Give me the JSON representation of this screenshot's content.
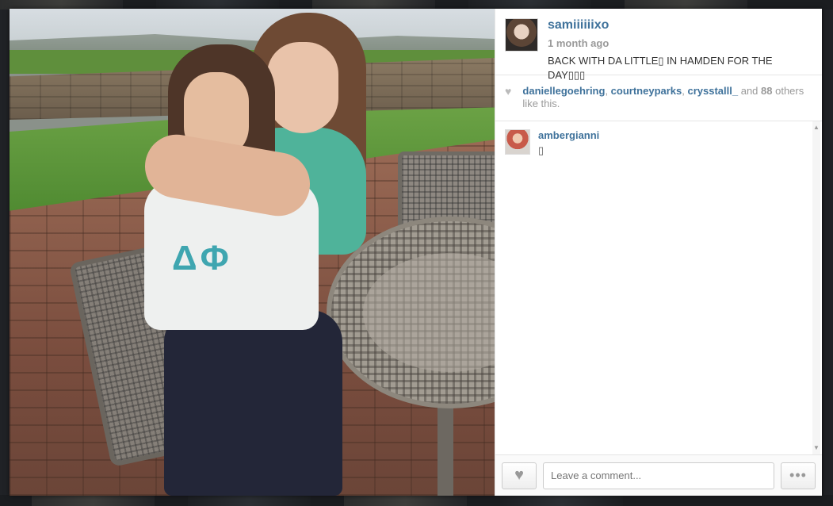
{
  "post": {
    "username": "samiiiiiixo",
    "time_ago": "1 month ago",
    "caption": "BACK WITH DA LITTLE▯ IN HAMDEN FOR THE DAY▯▯▯"
  },
  "likes": {
    "users": [
      "daniellegoehring",
      "courtneyparks",
      "crysstalll_"
    ],
    "separator1": ", ",
    "separator2": ", ",
    "and_text": " and ",
    "count": "88",
    "suffix": " others like this."
  },
  "comments": [
    {
      "username": "ambergianni",
      "text": "▯"
    }
  ],
  "footer": {
    "comment_placeholder": "Leave a comment...",
    "like_icon": "heart-icon",
    "more_icon": "ellipsis-icon"
  },
  "colors": {
    "link": "#3f729b",
    "muted": "#999999"
  }
}
